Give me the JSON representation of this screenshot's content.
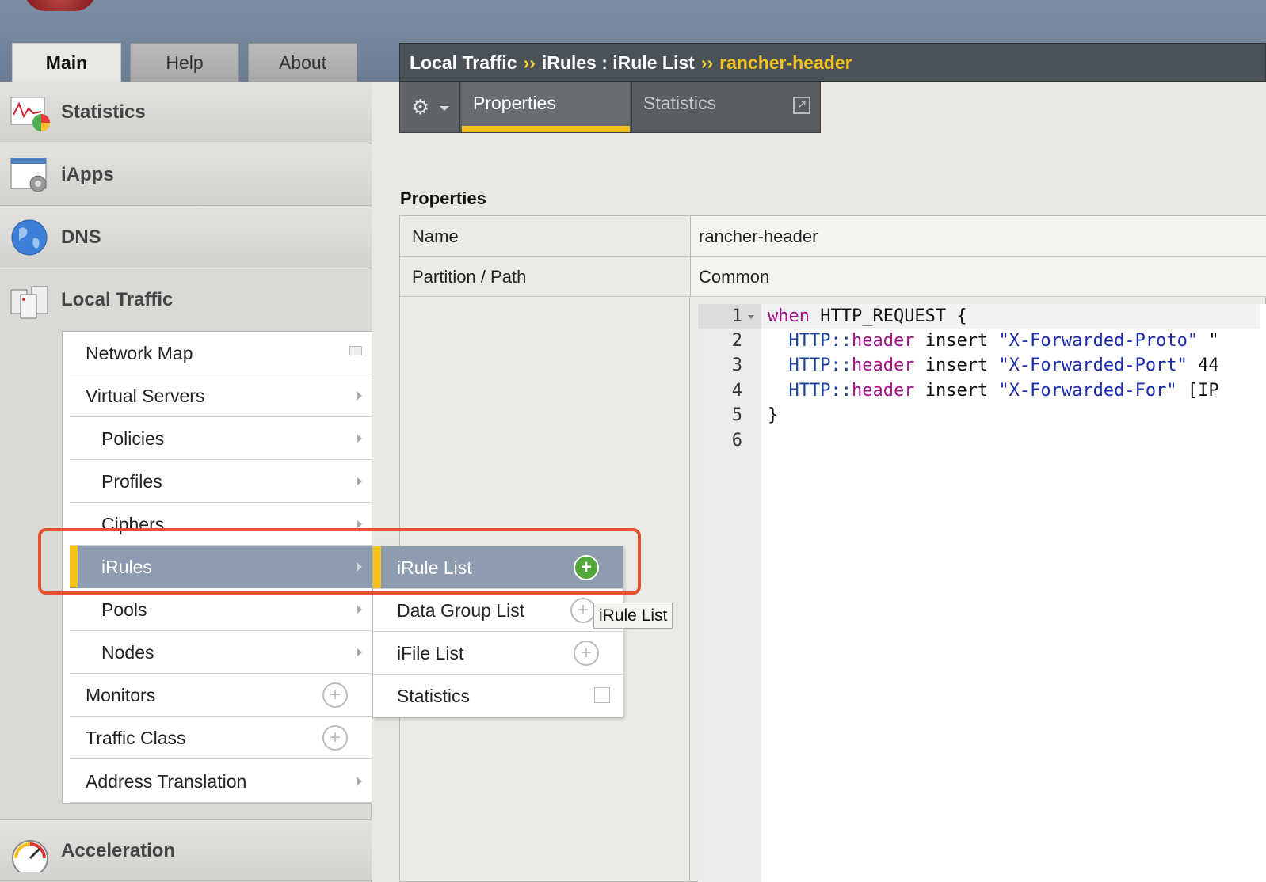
{
  "main_tabs": [
    "Main",
    "Help",
    "About"
  ],
  "breadcrumb": {
    "part1": "Local Traffic",
    "sep1": "››",
    "part2": "iRules : iRule List",
    "sep2": "››",
    "current": "rancher-header"
  },
  "sidebar": {
    "sections": {
      "statistics": "Statistics",
      "iapps": "iApps",
      "dns": "DNS",
      "local_traffic": "Local Traffic",
      "acceleration": "Acceleration"
    },
    "local_traffic_items": [
      "Network Map",
      "Virtual Servers",
      "Policies",
      "Profiles",
      "Ciphers",
      "iRules",
      "Pools",
      "Nodes",
      "Monitors",
      "Traffic Class",
      "Address Translation"
    ],
    "selected_item": "iRules"
  },
  "flyout": {
    "items": [
      "iRule List",
      "Data Group List",
      "iFile List",
      "Statistics"
    ],
    "selected_item": "iRule List",
    "tooltip": "iRule List"
  },
  "content_tabs": {
    "active": "Properties",
    "inactive": "Statistics"
  },
  "properties": {
    "title": "Properties",
    "rows": [
      {
        "key": "Name",
        "value": "rancher-header"
      },
      {
        "key": "Partition / Path",
        "value": "Common"
      }
    ]
  },
  "code": {
    "line_numbers": [
      "1",
      "2",
      "3",
      "4",
      "5",
      "6"
    ],
    "line1": {
      "kw": "when",
      "rest": " HTTP_REQUEST {"
    },
    "line2": {
      "ns": "HTTP::",
      "kw": "header",
      "mid": " insert ",
      "str": "\"X-Forwarded-Proto\"",
      "tail": " \""
    },
    "line3": {
      "ns": "HTTP::",
      "kw": "header",
      "mid": " insert ",
      "str": "\"X-Forwarded-Port\"",
      "tail": " 44"
    },
    "line4": {
      "ns": "HTTP::",
      "kw": "header",
      "mid": " insert ",
      "str": "\"X-Forwarded-For\"",
      "tail": " [IP"
    },
    "line5": "}",
    "line6": ""
  },
  "colors": {
    "accent_yellow": "#f3c11a",
    "selected_nav": "#8e9caf",
    "highlight_box": "#e4512d",
    "add_icon_green": "#52a63a"
  }
}
